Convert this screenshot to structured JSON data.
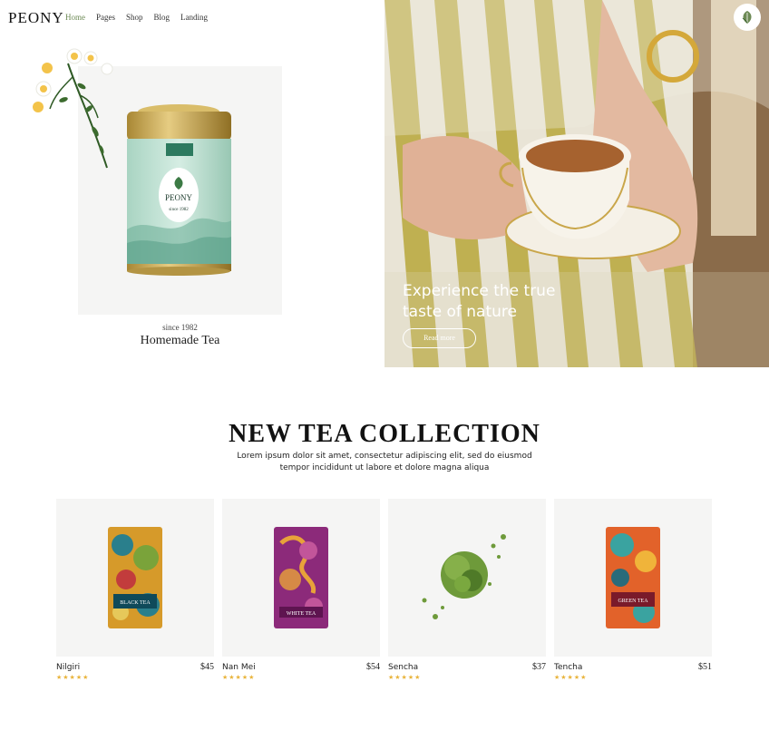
{
  "header": {
    "logo": "PEONY",
    "nav": [
      {
        "label": "Home",
        "active": true
      },
      {
        "label": "Pages",
        "active": false
      },
      {
        "label": "Shop",
        "active": false
      },
      {
        "label": "Blog",
        "active": false
      },
      {
        "label": "Landing",
        "active": false
      }
    ]
  },
  "hero_left": {
    "can_brand": "PEONY",
    "can_since": "since 1982",
    "since": "since 1982",
    "title": "Homemade Tea"
  },
  "hero_right": {
    "headline_line1": "Experience the true",
    "headline_line2": "taste of nature",
    "button": "Read more"
  },
  "collection": {
    "title": "NEW TEA COLLECTION",
    "desc_line1": "Lorem ipsum dolor sit amet, consectetur adipiscing elit, sed do eiusmod",
    "desc_line2": "tempor incididunt ut labore et dolore magna aliqua",
    "products": [
      {
        "name": "Nilgiri",
        "price": "$45",
        "rating": 5,
        "pack_label": "BLACK TEA"
      },
      {
        "name": "Nan Mei",
        "price": "$54",
        "rating": 5,
        "pack_label": "WHITE TEA"
      },
      {
        "name": "Sencha",
        "price": "$37",
        "rating": 5
      },
      {
        "name": "Tencha",
        "price": "$51",
        "rating": 5,
        "pack_label": "GREEN TEA"
      }
    ]
  },
  "colors": {
    "nav_active": "#6d8a55",
    "star": "#e9b43c",
    "card_bg": "#f5f5f4"
  }
}
